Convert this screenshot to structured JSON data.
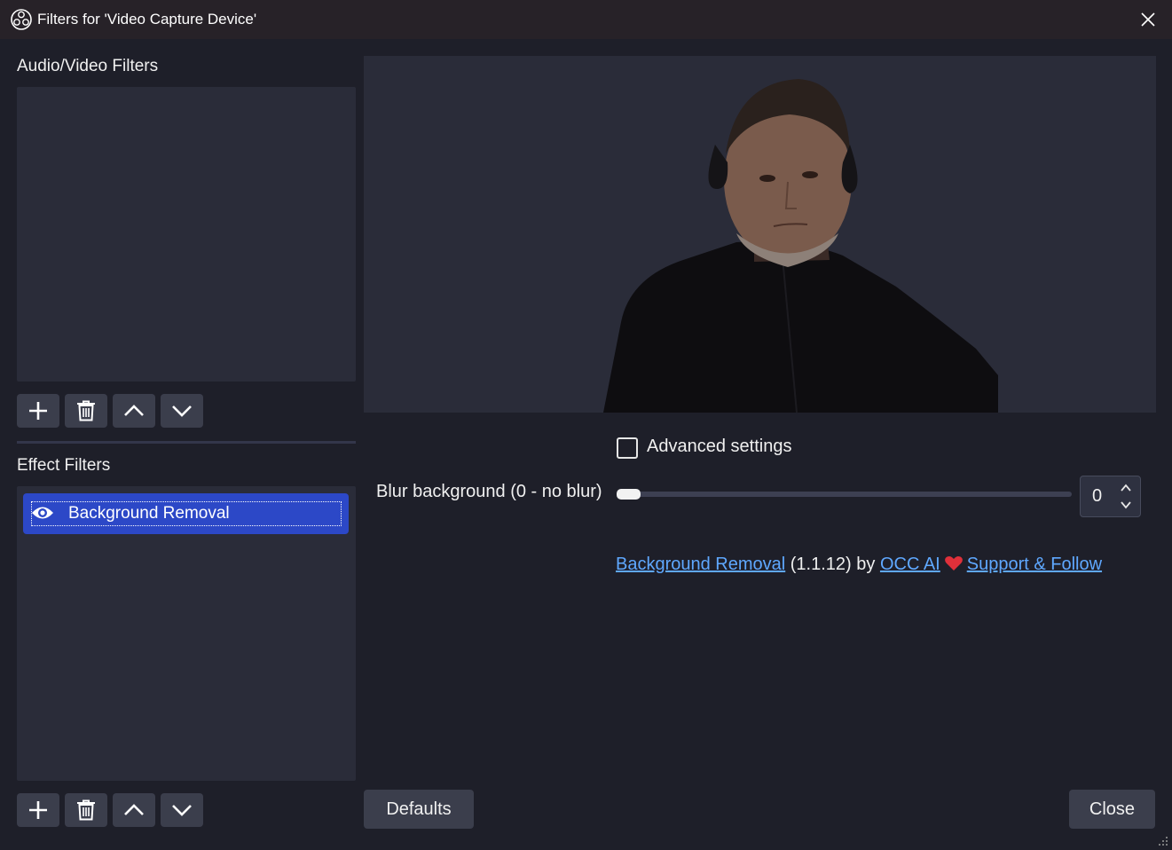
{
  "window": {
    "title": "Filters for 'Video Capture Device'",
    "close_icon": "close-icon",
    "app_icon": "obs-logo-icon"
  },
  "audio_video": {
    "label": "Audio/Video Filters",
    "items": [],
    "toolbar": [
      "add-icon",
      "trash-icon",
      "chevron-up-icon",
      "chevron-down-icon"
    ]
  },
  "effect": {
    "label": "Effect Filters",
    "items": [
      {
        "label": "Background Removal",
        "visible_icon": "eye-icon",
        "selected": true
      }
    ],
    "toolbar": [
      "add-icon",
      "trash-icon",
      "chevron-up-icon",
      "chevron-down-icon"
    ]
  },
  "settings": {
    "advanced_label": "Advanced settings",
    "advanced_checked": false,
    "blur_label": "Blur background (0 - no blur)",
    "blur_value": "0",
    "blur_min": 0
  },
  "credits": {
    "link1": "Background Removal",
    "version": " (1.1.12) by ",
    "link2": "OCC AI",
    "link3": "Support & Follow",
    "heart_icon": "heart-icon"
  },
  "buttons": {
    "defaults": "Defaults",
    "close": "Close"
  },
  "colors": {
    "accent": "#2c48c7",
    "link": "#5fa8ff",
    "background": "#1e1f29"
  }
}
